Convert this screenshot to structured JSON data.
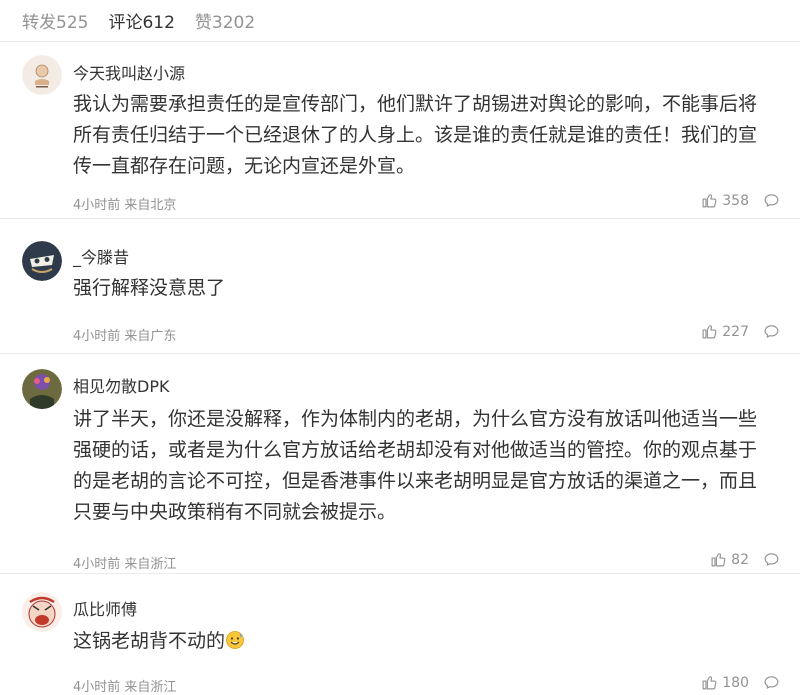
{
  "tabs": [
    {
      "label": "转发525"
    },
    {
      "label": "评论612"
    },
    {
      "label": "赞3202"
    }
  ],
  "comments": [
    {
      "user": "今天我叫赵小源",
      "text": "我认为需要承担责任的是宣传部门，他们默许了胡锡进对舆论的影响，不能事后将所有责任归结于一个已经退休了的人身上。该是谁的责任就是谁的责任！我们的宣传一直都存在问题，无论内宣还是外宣。",
      "meta": "4小时前 来自北京",
      "likes": "358"
    },
    {
      "user": "_今滕昔",
      "text": "强行解释没意思了",
      "meta": "4小时前 来自广东",
      "likes": "227"
    },
    {
      "user": "相见勿散DPK",
      "text": "讲了半天，你还是没解释，作为体制内的老胡，为什么官方没有放话叫他适当一些强硬的话，或者是为什么官方放话给老胡却没有对他做适当的管控。你的观点基于的是老胡的言论不可控，但是香港事件以来老胡明显是官方放话的渠道之一，而且只要与中央政策稍有不同就会被提示。",
      "meta": "4小时前 来自浙江",
      "likes": "82"
    },
    {
      "user": "瓜比师傅",
      "text": "这锅老胡背不动的",
      "meta": "4小时前 来自浙江",
      "likes": "180"
    }
  ],
  "icons": {
    "like": "thumbs-up-icon",
    "reply": "comment-bubble-icon",
    "emoji": "sweat-smile-emoji"
  }
}
